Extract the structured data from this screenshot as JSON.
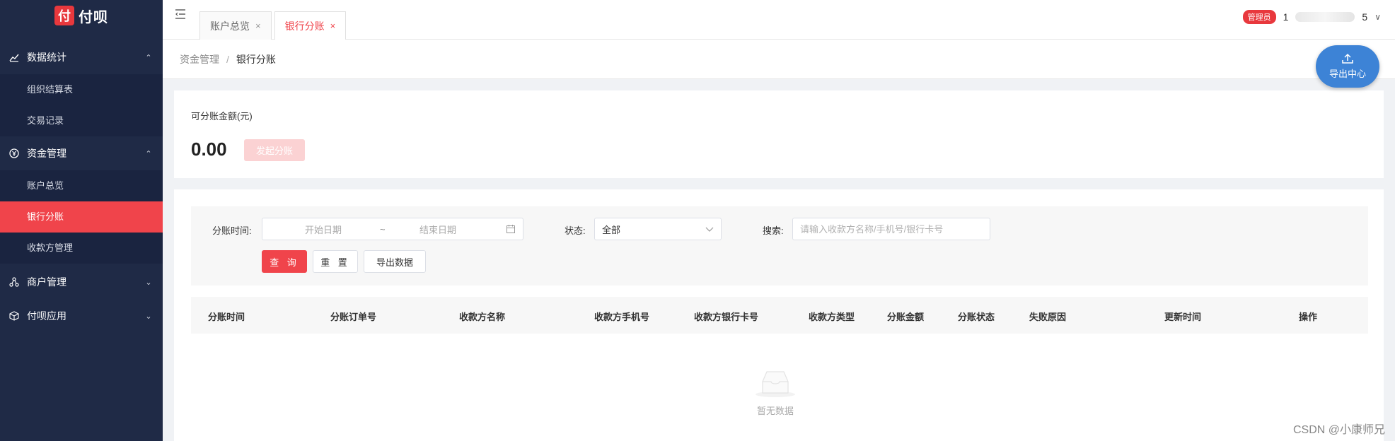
{
  "sidebar": {
    "logo_mark": "付",
    "logo_text": "付呗",
    "groups": [
      {
        "label": "数据统计",
        "expanded": true,
        "items": [
          {
            "label": "组织结算表"
          },
          {
            "label": "交易记录"
          }
        ]
      },
      {
        "label": "资金管理",
        "expanded": true,
        "items": [
          {
            "label": "账户总览"
          },
          {
            "label": "银行分账",
            "active": true
          },
          {
            "label": "收款方管理"
          }
        ]
      },
      {
        "label": "商户管理",
        "expanded": false,
        "items": []
      },
      {
        "label": "付呗应用",
        "expanded": false,
        "items": []
      }
    ]
  },
  "header": {
    "tabs": [
      {
        "label": "账户总览",
        "active": false
      },
      {
        "label": "银行分账",
        "active": true
      }
    ],
    "user": {
      "role_badge": "管理员",
      "name_start": "1",
      "name_end": "5"
    }
  },
  "breadcrumb": {
    "parent": "资金管理",
    "current": "银行分账"
  },
  "export_center": {
    "label": "导出中心"
  },
  "balance": {
    "label": "可分账金额(元)",
    "value": "0.00",
    "split_button": "发起分账"
  },
  "filter": {
    "time_label": "分账时间:",
    "start_placeholder": "开始日期",
    "separator": "~",
    "end_placeholder": "结束日期",
    "status_label": "状态:",
    "status_value": "全部",
    "search_label": "搜索:",
    "search_placeholder": "请输入收款方名称/手机号/银行卡号",
    "query_button": "查 询",
    "reset_button": "重 置",
    "export_button": "导出数据"
  },
  "table": {
    "columns": [
      "分账时间",
      "分账订单号",
      "收款方名称",
      "收款方手机号",
      "收款方银行卡号",
      "收款方类型",
      "分账金额",
      "分账状态",
      "失败原因",
      "更新时间",
      "操作"
    ],
    "rows": [],
    "empty_text": "暂无数据"
  },
  "watermark": "CSDN @小康师兄",
  "colors": {
    "accent": "#f0444b",
    "sidebar_bg": "#1f2a46",
    "export_blue": "#3d83d6"
  }
}
